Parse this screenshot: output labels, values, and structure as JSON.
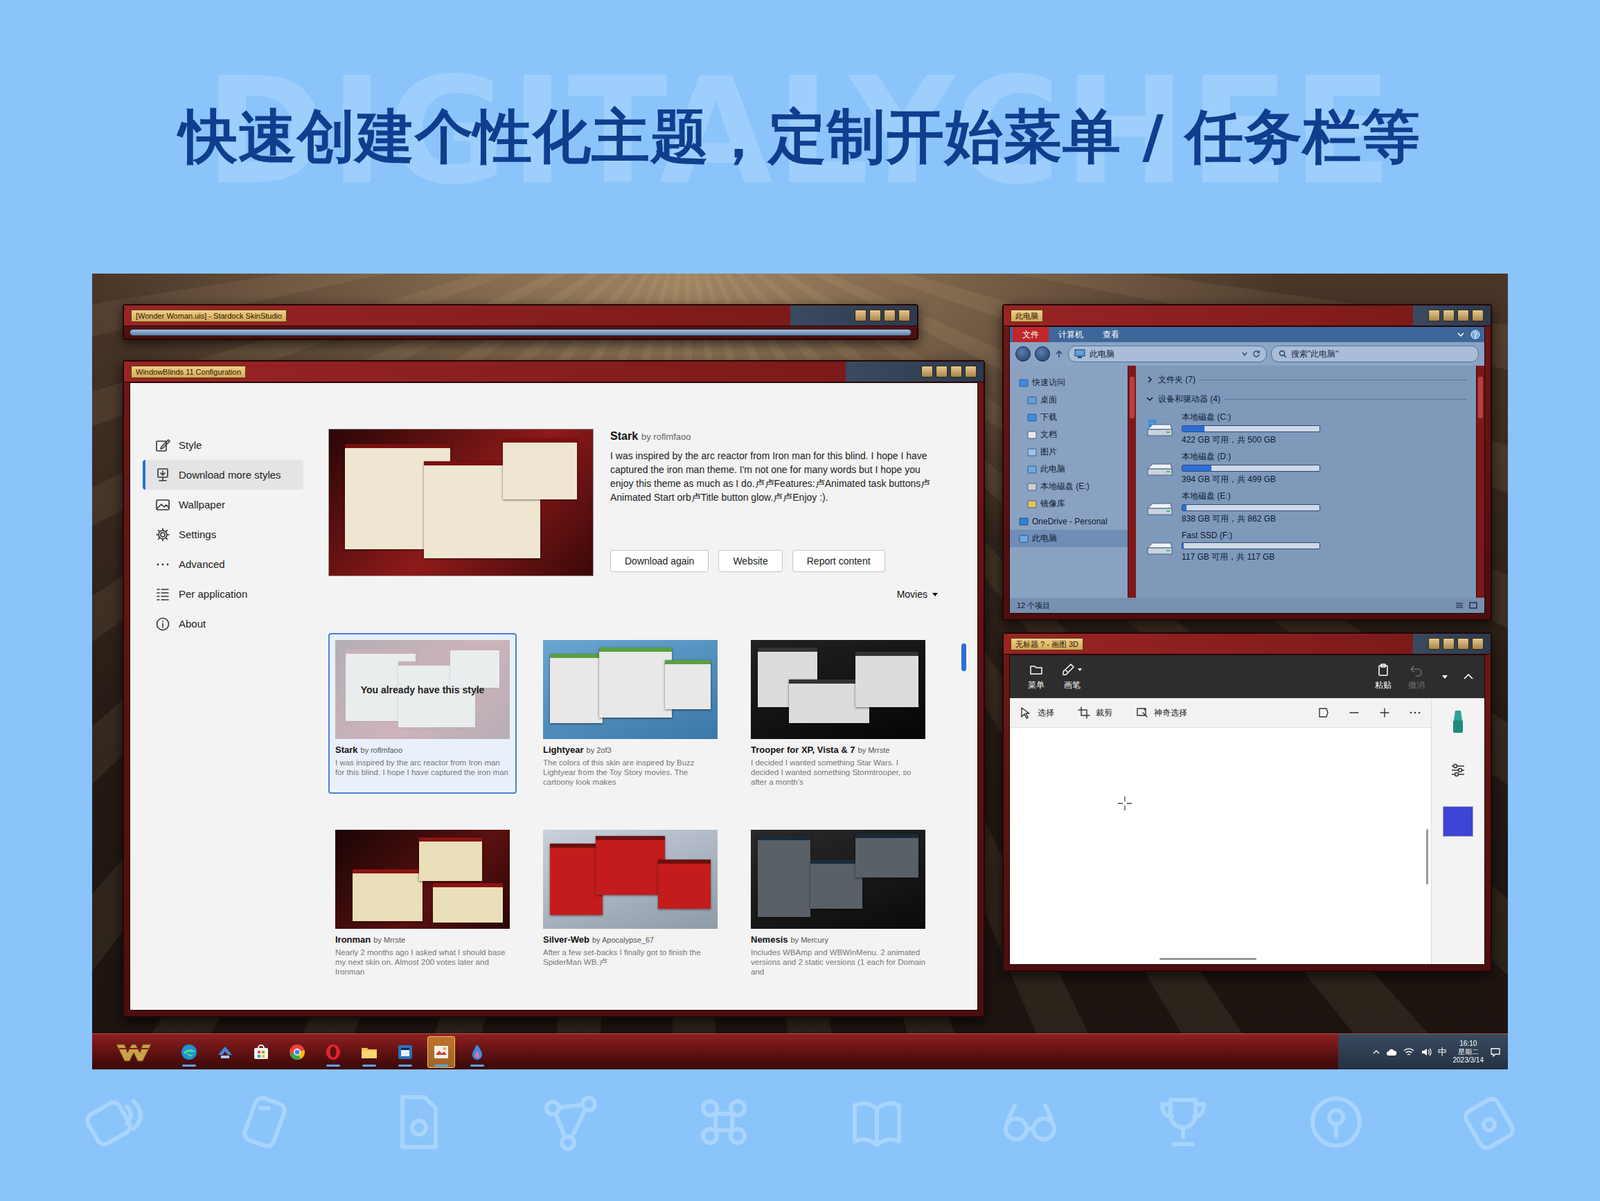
{
  "headline": "快速创建个性化主题，定制开始菜单 / 任务栏等",
  "watermark": "DIGITALYCHEE",
  "skinstudio": {
    "title": "[Wonder Woman.uis] - Stardock SkinStudio"
  },
  "config": {
    "title": "WindowBlinds 11 Configuration",
    "sidebar": [
      {
        "label": "Style",
        "selected": false
      },
      {
        "label": "Download more styles",
        "selected": true
      },
      {
        "label": "Wallpaper",
        "selected": false
      },
      {
        "label": "Settings",
        "selected": false
      },
      {
        "label": "Advanced",
        "selected": false
      },
      {
        "label": "Per application",
        "selected": false
      },
      {
        "label": "About",
        "selected": false
      }
    ],
    "featured": {
      "title": "Stark",
      "author": "by roflmfaoo",
      "description": "I was inspired by the arc reactor from Iron man for this blind. I hope I have captured the iron man theme. I'm not one for many words but I hope you enjoy this theme as much as I do.卢卢Features:卢Animated task buttons卢Animated Start orb卢Title button glow.卢卢Enjoy :).",
      "buttons": [
        "Download again",
        "Website",
        "Report content"
      ]
    },
    "filter": "Movies",
    "cards": [
      {
        "title": "Stark",
        "author": "by roflmfaoo",
        "description": "I was inspired by the arc reactor from Iron man for this blind. I hope I have captured the iron man",
        "selected": true,
        "overlay": "You already have this style"
      },
      {
        "title": "Lightyear",
        "author": "by 2of3",
        "description": "The colors of this skin are inspired by Buzz Lightyear from the Toy Story movies. The cartoony look makes",
        "selected": false
      },
      {
        "title": "Trooper for XP, Vista & 7",
        "author": "by Mrrste",
        "description": "I decided I wanted something Star Wars. I decided I wanted something Stormtrooper, so after a month's",
        "selected": false
      },
      {
        "title": "Ironman",
        "author": "by Mrrste",
        "description": "Nearly 2 months ago I asked what I should base my next skin on. Almost 200 votes later and Ironman",
        "selected": false
      },
      {
        "title": "Silver-Web",
        "author": "by Apocalypse_67",
        "description": "After a few set-backs I finally got to finish the SpiderMan WB.卢",
        "selected": false
      },
      {
        "title": "Nemesis",
        "author": "by Mercury",
        "description": "Includes WBAmp and WBWinMenu. 2 animated versions and 2 static versions (1 each for Domain and",
        "selected": false
      }
    ]
  },
  "explorer": {
    "title": "此电脑",
    "tabs": [
      {
        "label": "文件",
        "selected": true
      },
      {
        "label": "计算机",
        "selected": false
      },
      {
        "label": "查看",
        "selected": false
      }
    ],
    "address": "此电脑",
    "search": "搜索\"此电脑\"",
    "nav": [
      {
        "label": "快速访问",
        "depth": 0,
        "selected": false
      },
      {
        "label": "桌面",
        "depth": 1,
        "selected": false
      },
      {
        "label": "下载",
        "depth": 1,
        "selected": false
      },
      {
        "label": "文档",
        "depth": 1,
        "selected": false
      },
      {
        "label": "图片",
        "depth": 1,
        "selected": false
      },
      {
        "label": "此电脑",
        "depth": 1,
        "selected": false
      },
      {
        "label": "本地磁盘 (E:)",
        "depth": 1,
        "selected": false
      },
      {
        "label": "镜像库",
        "depth": 1,
        "selected": false
      },
      {
        "label": "OneDrive - Personal",
        "depth": 0,
        "selected": false
      },
      {
        "label": "此电脑",
        "depth": 0,
        "selected": true
      }
    ],
    "groups": [
      {
        "label": "文件夹 (7)",
        "expanded": false
      },
      {
        "label": "设备和驱动器 (4)",
        "expanded": true
      }
    ],
    "drives": [
      {
        "name": "本地磁盘 (C:)",
        "free": "422 GB 可用，共 500 GB",
        "level": 0.16
      },
      {
        "name": "本地磁盘 (D:)",
        "free": "394 GB 可用，共 499 GB",
        "level": 0.21
      },
      {
        "name": "本地磁盘 (E:)",
        "free": "838 GB 可用，共 862 GB",
        "level": 0.03
      },
      {
        "name": "Fast SSD (F:)",
        "free": "117 GB 可用，共 117 GB",
        "level": 0.01
      }
    ],
    "status": "12 个项目"
  },
  "paint": {
    "title": "无标题 ? - 画图 3D",
    "tools": [
      {
        "label": "菜单",
        "disabled": false
      },
      {
        "label": "画笔",
        "disabled": false
      },
      {
        "label": "粘贴",
        "disabled": false
      },
      {
        "label": "撤消",
        "disabled": true
      }
    ],
    "subtools": [
      "选择",
      "裁剪",
      "神奇选择"
    ],
    "color": "#3d44d6"
  },
  "taskbar": {
    "apps": [
      {
        "running": true,
        "active": false
      },
      {
        "running": false,
        "active": false
      },
      {
        "running": false,
        "active": false
      },
      {
        "running": false,
        "active": false
      },
      {
        "running": true,
        "active": false
      },
      {
        "running": true,
        "active": false
      },
      {
        "running": true,
        "active": false
      },
      {
        "running": true,
        "active": true
      },
      {
        "running": true,
        "active": false
      }
    ],
    "ime": "中",
    "time": "16:10",
    "weekday": "星期二",
    "date": "2023/3/14"
  }
}
